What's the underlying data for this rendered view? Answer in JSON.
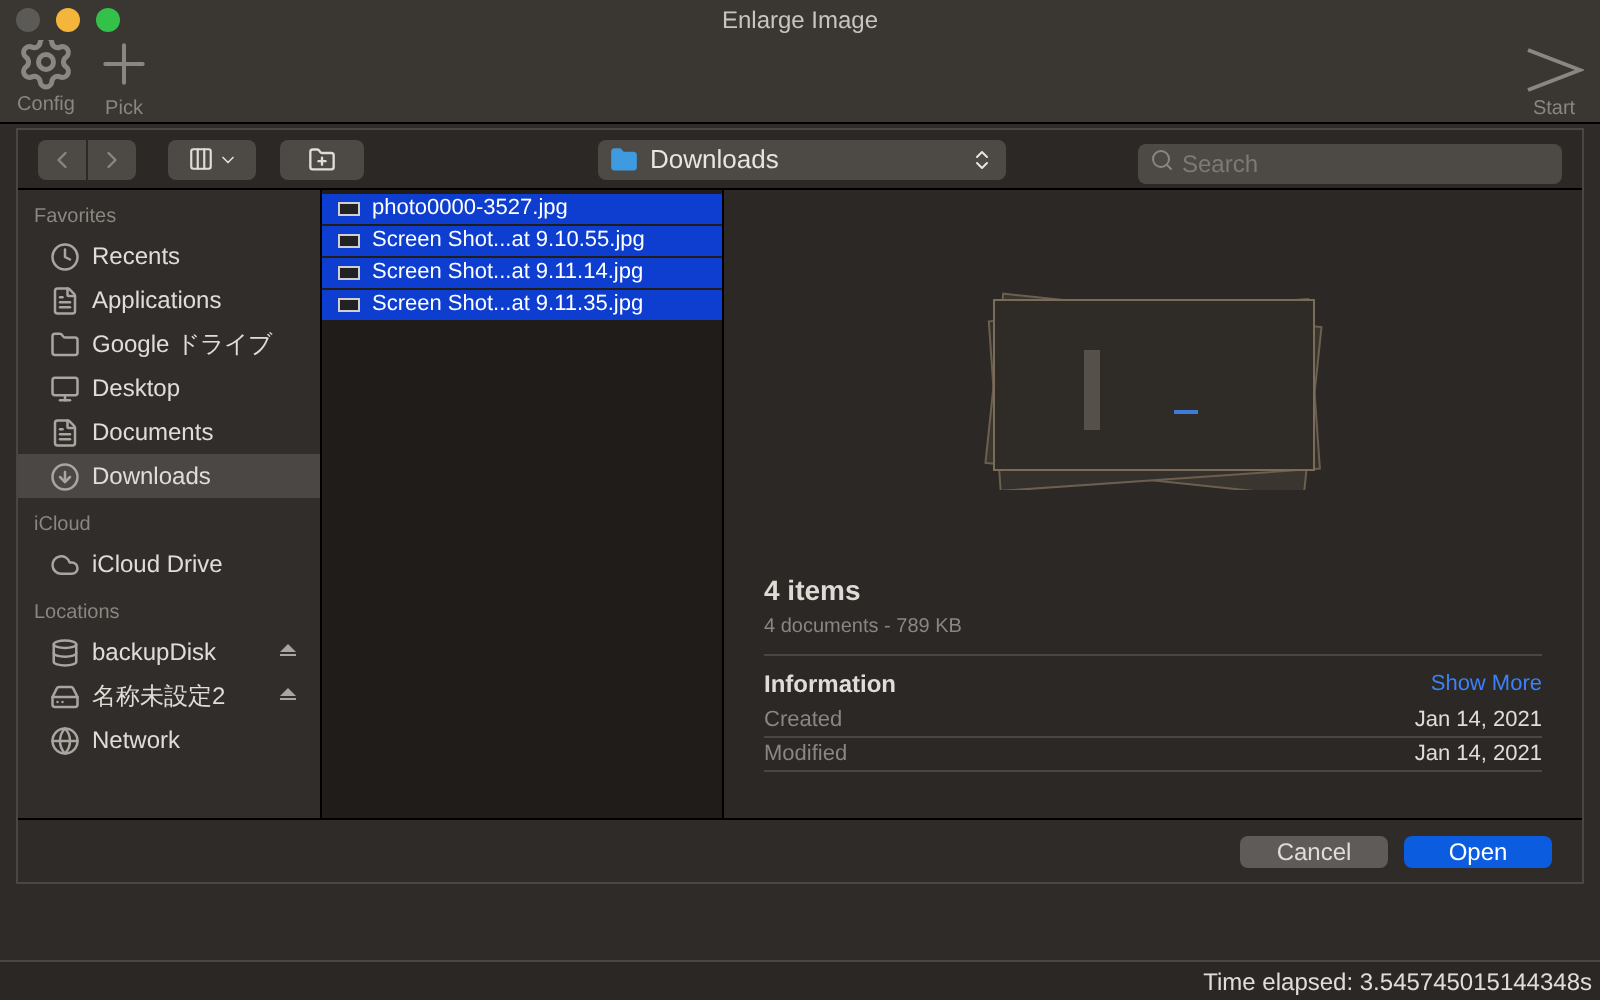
{
  "window": {
    "title": "Enlarge Image"
  },
  "toolbar": [
    {
      "label": "Config",
      "kind": "gear"
    },
    {
      "label": "Pick",
      "kind": "plus"
    },
    {
      "label": "Start",
      "kind": "arrow"
    }
  ],
  "dialog": {
    "location": "Downloads",
    "search": {
      "placeholder": "Search"
    },
    "sidebar": [
      {
        "heading": "Favorites",
        "items": [
          {
            "label": "Recents",
            "kind": "recents",
            "selected": false,
            "eject": false
          },
          {
            "label": "Applications",
            "kind": "apps",
            "selected": false,
            "eject": false
          },
          {
            "label": "Google ドライブ",
            "kind": "folder",
            "selected": false,
            "eject": false
          },
          {
            "label": "Desktop",
            "kind": "desktop",
            "selected": false,
            "eject": false
          },
          {
            "label": "Documents",
            "kind": "doc",
            "selected": false,
            "eject": false
          },
          {
            "label": "Downloads",
            "kind": "download",
            "selected": true,
            "eject": false
          }
        ]
      },
      {
        "heading": "iCloud",
        "items": [
          {
            "label": "iCloud Drive",
            "kind": "cloud",
            "selected": false,
            "eject": false
          }
        ]
      },
      {
        "heading": "Locations",
        "items": [
          {
            "label": "backupDisk",
            "kind": "disk",
            "selected": false,
            "eject": true
          },
          {
            "label": "名称未設定2",
            "kind": "drive",
            "selected": false,
            "eject": true
          },
          {
            "label": "Network",
            "kind": "globe",
            "selected": false,
            "eject": false
          }
        ]
      }
    ],
    "files": [
      {
        "name": "photo0000-3527.jpg",
        "selected": true
      },
      {
        "name": "Screen Shot...at 9.10.55.jpg",
        "selected": true
      },
      {
        "name": "Screen Shot...at 9.11.14.jpg",
        "selected": true
      },
      {
        "name": "Screen Shot...at 9.11.35.jpg",
        "selected": true
      }
    ],
    "preview": {
      "title": "4 items",
      "subtitle": "4 documents - 789 KB",
      "info_heading": "Information",
      "show_more": "Show More",
      "rows": [
        {
          "label": "Created",
          "value": "Jan 14, 2021"
        },
        {
          "label": "Modified",
          "value": "Jan 14, 2021"
        }
      ]
    },
    "buttons": [
      {
        "label": "Cancel",
        "kind": "secondary"
      },
      {
        "label": "Open",
        "kind": "primary"
      }
    ]
  },
  "status_bar": "Time elapsed: 3.545745015144348s"
}
